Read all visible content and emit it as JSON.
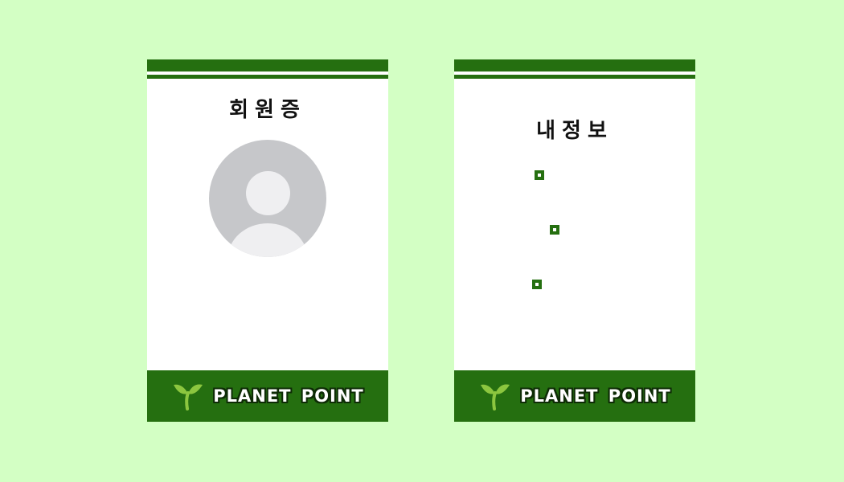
{
  "colors": {
    "background": "#d3ffc4",
    "accent": "#256f10",
    "card": "#ffffff"
  },
  "member_card": {
    "title": "회원증",
    "avatar_icon": "default-user-avatar-icon",
    "footer": {
      "logo_icon": "seedling-icon",
      "brand": "PLANET POINT"
    }
  },
  "info_card": {
    "title": "내정보",
    "bullet_icon": "square-bullet-icon",
    "bullet_count_note": null,
    "footer": {
      "logo_icon": "seedling-icon",
      "brand": "PLANET POINT"
    }
  }
}
